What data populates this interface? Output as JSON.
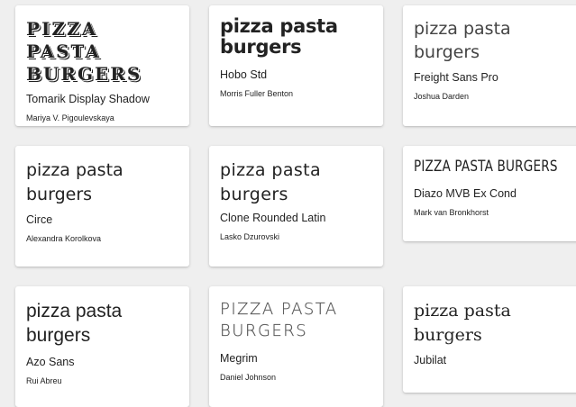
{
  "cards": [
    {
      "sample": "pizza pasta burgers",
      "font_name": "Tomarik Display Shadow",
      "designer": "Mariya V. Pigoulevskaya"
    },
    {
      "sample": "pizza pasta burgers",
      "font_name": "Hobo Std",
      "designer": "Morris Fuller Benton"
    },
    {
      "sample": "pizza pasta burgers",
      "font_name": "Freight Sans Pro",
      "designer": "Joshua Darden"
    },
    {
      "sample": "pizza pasta burgers",
      "font_name": "Circe",
      "designer": "Alexandra Korolkova"
    },
    {
      "sample": "pizza pasta burgers",
      "font_name": "Clone Rounded Latin",
      "designer": "Lasko Dzurovski"
    },
    {
      "sample": "PIZZA PASTA BURGERS",
      "font_name": "Diazo MVB Ex Cond",
      "designer": "Mark van Bronkhorst"
    },
    {
      "sample": "pizza pasta burgers",
      "font_name": "Azo Sans",
      "designer": "Rui Abreu"
    },
    {
      "sample": "pizza pasta burgers",
      "font_name": "Megrim",
      "designer": "Daniel Johnson"
    },
    {
      "sample": "pizza pasta burgers",
      "font_name": "Jubilat",
      "designer": ""
    }
  ]
}
